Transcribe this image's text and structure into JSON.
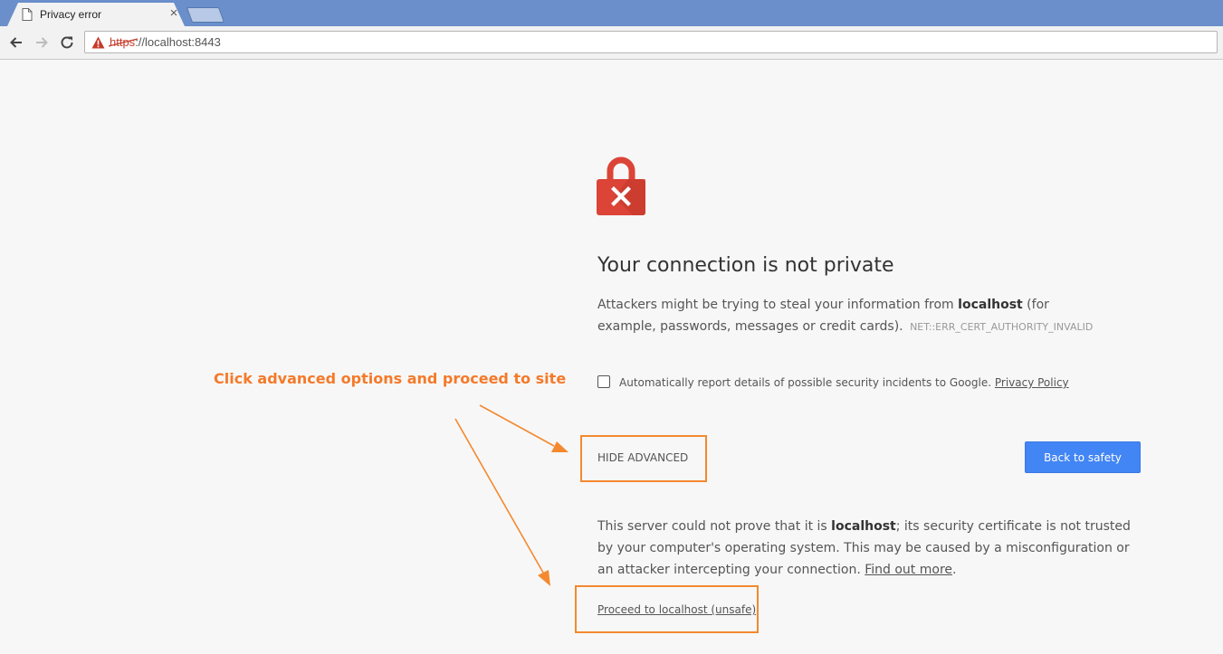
{
  "browser": {
    "tab_title": "Privacy error",
    "tab_close": "×",
    "url_scheme": "https",
    "url_rest": "://localhost:8443"
  },
  "interstitial": {
    "heading": "Your connection is not private",
    "desc_before": "Attackers might be trying to steal your information from ",
    "desc_host": "localhost",
    "desc_after": " (for example, passwords, messages or credit cards).",
    "error_code": "NET::ERR_CERT_AUTHORITY_INVALID",
    "report_checkbox_checked": false,
    "report_text": "Automatically report details of possible security incidents to Google.",
    "privacy_policy": "Privacy Policy",
    "hide_advanced": "HIDE ADVANCED",
    "back_to_safety": "Back to safety",
    "details_before": "This server could not prove that it is ",
    "details_host": "localhost",
    "details_after": "; its security certificate is not trusted by your computer's operating system. This may be caused by a misconfiguration or an attacker intercepting your connection.",
    "find_out_more": "Find out more",
    "details_end": ".",
    "proceed_link": "Proceed to localhost (unsafe)"
  },
  "annotation": {
    "text": "Click advanced options and proceed to site",
    "color": "#f47a2a"
  },
  "colors": {
    "tabstrip": "#6a8fca",
    "error_red": "#db4437",
    "button_blue": "#4285f4"
  },
  "icons": {
    "tab": "page-icon",
    "back": "back-arrow-icon",
    "forward": "forward-arrow-icon",
    "reload": "reload-icon",
    "omnibox": "warning-triangle-icon",
    "hero": "broken-lock-icon"
  }
}
